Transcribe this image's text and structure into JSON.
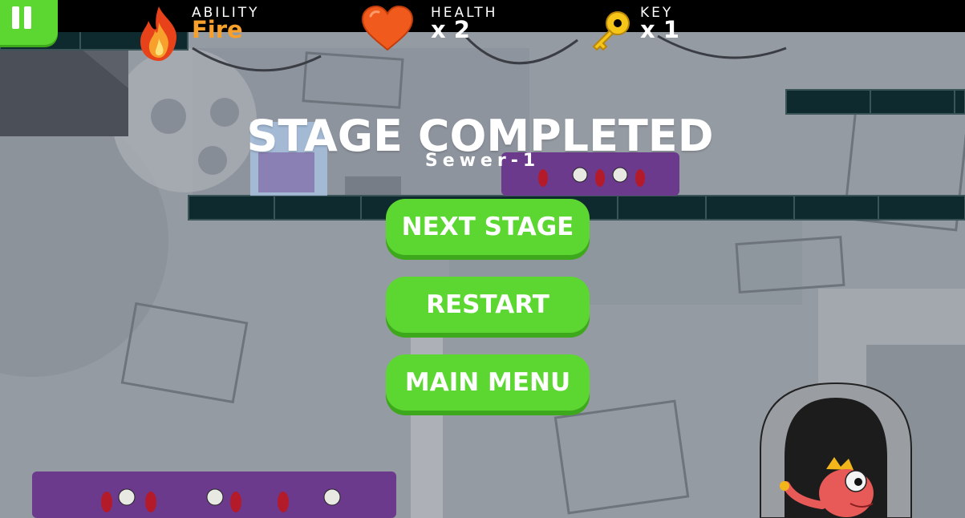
{
  "hud": {
    "pause_icon": "pause-icon",
    "ability": {
      "label": "ABILITY",
      "value": "Fire",
      "icon": "fire-icon",
      "value_color": "#f7a02b"
    },
    "health": {
      "label": "HEALTH",
      "value": "x 2",
      "icon": "heart-icon",
      "icon_color": "#f05a1c"
    },
    "key": {
      "label": "KEY",
      "value": "x 1",
      "icon": "key-icon",
      "icon_color": "#f5c518"
    }
  },
  "stage": {
    "title": "STAGE COMPLETED",
    "subtitle": "Sewer-1"
  },
  "menu": {
    "next_label": "NEXT STAGE",
    "restart_label": "RESTART",
    "main_menu_label": "MAIN MENU",
    "button_color": "#5cd630"
  },
  "colors": {
    "hud_bg": "#000000",
    "platform": "#0f2a2e",
    "enemy": "#6b3a8c"
  }
}
